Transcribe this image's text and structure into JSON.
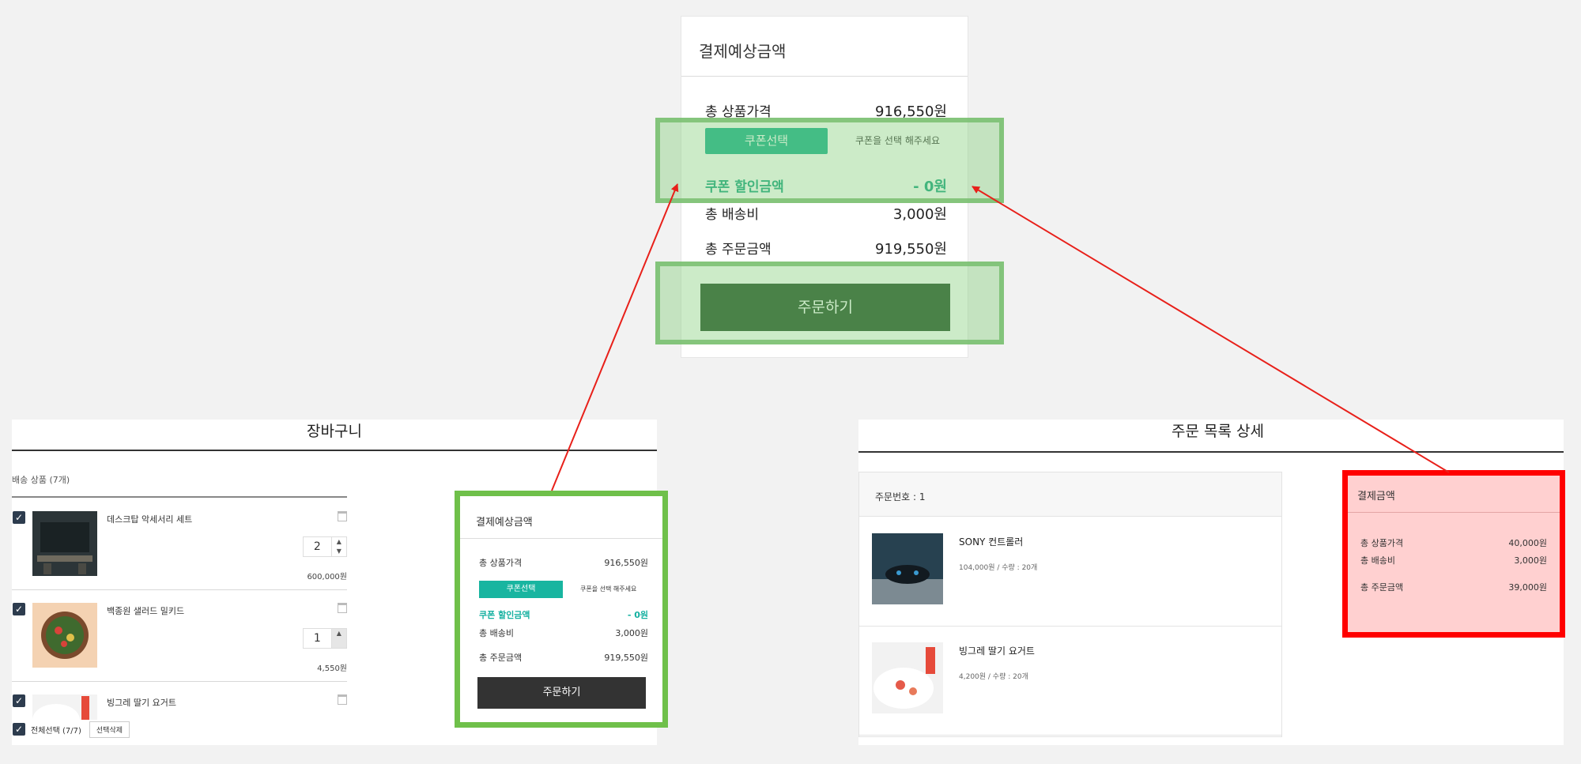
{
  "top_summary": {
    "title": "결제예상금액",
    "product_total_label": "총 상품가격",
    "product_total_value": "916,550원",
    "coupon_button": "쿠폰선택",
    "coupon_hint": "쿠폰을 선택 해주세요",
    "coupon_discount_label": "쿠폰 할인금액",
    "coupon_discount_value": "- 0원",
    "shipping_label": "총 배송비",
    "shipping_value": "3,000원",
    "order_total_label": "총 주문금액",
    "order_total_value": "919,550원",
    "order_button": "주문하기"
  },
  "cart": {
    "title": "장바구니",
    "section_label": "배송 상품 (7개)",
    "items": [
      {
        "name": "데스크탑 악세서리 세트",
        "qty": "2",
        "price": "600,000원"
      },
      {
        "name": "백종원 샐러드 밀키드",
        "qty": "1",
        "price": "4,550원"
      },
      {
        "name": "빙그레 딸기 요거트"
      }
    ],
    "select_all_label": "전체선택 (7/7)",
    "delete_selected": "선택삭제",
    "summary": {
      "title": "결제예상금액",
      "product_total_label": "총 상품가격",
      "product_total_value": "916,550원",
      "coupon_button": "쿠폰선택",
      "coupon_hint": "쿠폰을 선택 해주세요",
      "coupon_discount_label": "쿠폰 할인금액",
      "coupon_discount_value": "- 0원",
      "shipping_label": "총 배송비",
      "shipping_value": "3,000원",
      "order_total_label": "총 주문금액",
      "order_total_value": "919,550원",
      "order_button": "주문하기"
    }
  },
  "order_detail": {
    "title": "주문 목록 상세",
    "order_number": "주문번호 : 1",
    "items": [
      {
        "name": "SONY 컨트롤러",
        "meta": "104,000원 / 수량 : 20개"
      },
      {
        "name": "빙그레 딸기 요거트",
        "meta": "4,200원 / 수량 : 20개"
      }
    ],
    "payment": {
      "title": "결제금액",
      "product_total_label": "총 상품가격",
      "product_total_value": "40,000원",
      "shipping_label": "총 배송비",
      "shipping_value": "3,000원",
      "order_total_label": "총 주문금액",
      "order_total_value": "39,000원"
    }
  },
  "colors": {
    "coupon_green": "#16b08c",
    "order_dark_green": "#1f4a24",
    "highlight_green": "#6fc04a",
    "highlight_red": "#ff0000"
  }
}
